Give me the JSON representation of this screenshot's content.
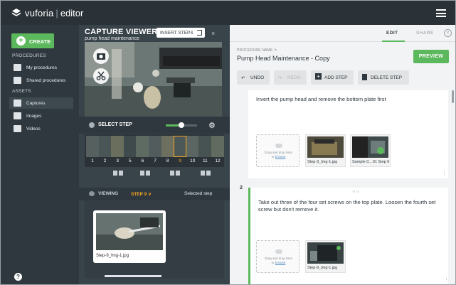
{
  "brand": {
    "logo_text": "vuforia",
    "separator": "|",
    "product": "editor"
  },
  "sidebar": {
    "create_label": "CREATE",
    "procedures_heading": "PROCEDURES",
    "procedures": [
      {
        "label": "My procedures",
        "icon": "person-icon"
      },
      {
        "label": "Shared procedures",
        "icon": "share-icon"
      }
    ],
    "assets_heading": "ASSETS",
    "assets": [
      {
        "label": "Captures",
        "icon": "capture-icon",
        "active": true
      },
      {
        "label": "Images",
        "icon": "image-icon"
      },
      {
        "label": "Videos",
        "icon": "video-icon"
      }
    ],
    "help_label": "?"
  },
  "capture": {
    "title": "CAPTURE VIEWER |",
    "subtitle": "pump head maintenance",
    "insert_label": "INSERT STEPS",
    "close_label": "×",
    "select_step_label": "SELECT STEP",
    "zoom_level": 0.5,
    "frames": [
      "1",
      "2",
      "3",
      "5",
      "6",
      "7",
      "8",
      "9",
      "10",
      "11",
      "12"
    ],
    "current_frame": "9",
    "viewing_label": "VIEWING",
    "step_label": "STEP 9 ∨",
    "selected_step_label": "Selected step",
    "card_label": "Step-9_Img-1.jpg"
  },
  "editor": {
    "tab_edit": "EDIT",
    "tab_share": "SHARE",
    "close_label": "×",
    "procedure_name_label": "PROCEDURE NAME",
    "procedure_name": "Pump Head Maintenance - Copy",
    "preview_label": "PREVIEW",
    "undo_label": "UNDO",
    "redo_label": "REDO",
    "add_step_label": "ADD STEP",
    "delete_step_label": "DELETE STEP",
    "drop_text": "Drag and drop here",
    "drop_or": "or",
    "drop_link": "browse",
    "steps": [
      {
        "text": "Invert the pump head and remove the bottom plate first",
        "images": [
          "Step-3_Img-1.jpg",
          "Sample C...01 Step 6"
        ]
      },
      {
        "number": "2",
        "text": "Take out three of the four set screws on the top plate.  Loosen the fourth set screw but don't remove it.",
        "images": [
          "Step-9_Img-1.jpg"
        ]
      }
    ]
  },
  "colors": {
    "accent": "#5cb85c",
    "highlight": "#f5a623",
    "sidebar": "#2f383f",
    "topbar": "#2a3238"
  }
}
